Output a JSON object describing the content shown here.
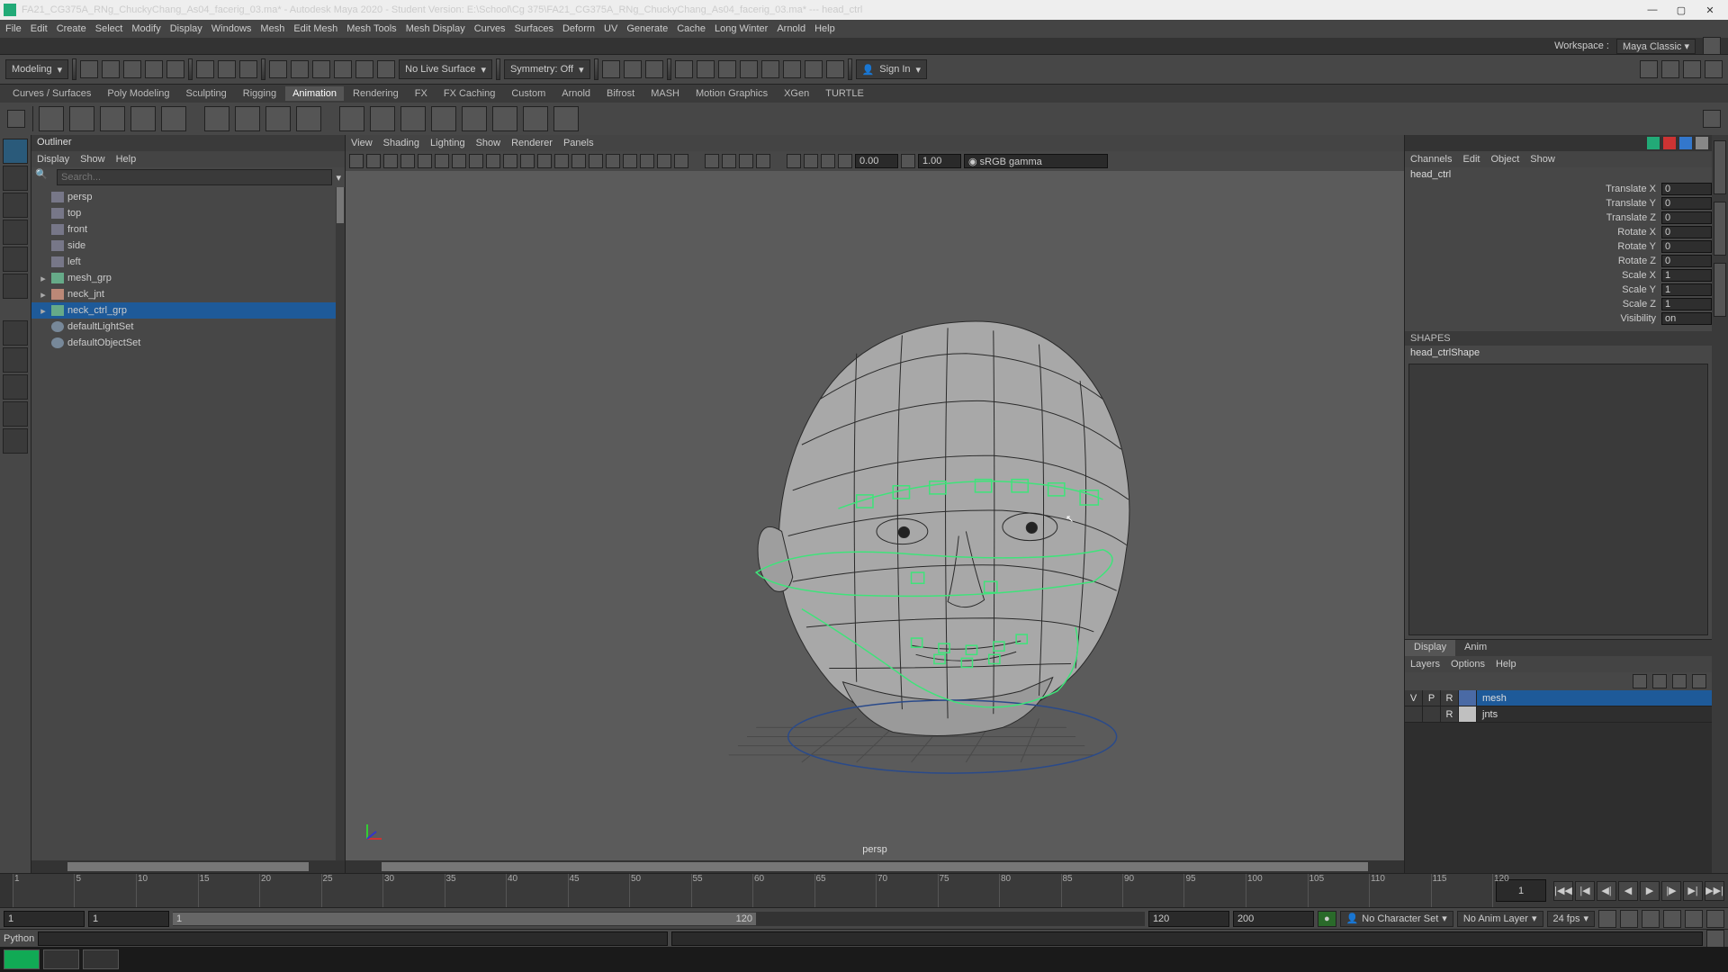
{
  "title": "FA21_CG375A_RNg_ChuckyChang_As04_facerig_03.ma* - Autodesk Maya 2020 - Student Version: E:\\School\\Cg 375\\FA21_CG375A_RNg_ChuckyChang_As04_facerig_03.ma*  ---  head_ctrl",
  "menus": [
    "File",
    "Edit",
    "Create",
    "Select",
    "Modify",
    "Display",
    "Windows",
    "Mesh",
    "Edit Mesh",
    "Mesh Tools",
    "Mesh Display",
    "Curves",
    "Surfaces",
    "Deform",
    "UV",
    "Generate",
    "Cache",
    "Long Winter",
    "Arnold",
    "Help"
  ],
  "workspace": {
    "label": "Workspace :",
    "value": "Maya Classic"
  },
  "menuSet": "Modeling",
  "statusCombos": {
    "liveSurface": "No Live Surface",
    "symmetry": "Symmetry: Off",
    "signIn": "Sign In"
  },
  "shelfTabs": [
    "Curves / Surfaces",
    "Poly Modeling",
    "Sculpting",
    "Rigging",
    "Animation",
    "Rendering",
    "FX",
    "FX Caching",
    "Custom",
    "Arnold",
    "Bifrost",
    "MASH",
    "Motion Graphics",
    "XGen",
    "TURTLE"
  ],
  "shelfActive": "Animation",
  "outliner": {
    "title": "Outliner",
    "menus": [
      "Display",
      "Show",
      "Help"
    ],
    "searchPlaceholder": "Search...",
    "items": [
      {
        "label": "persp",
        "type": "cam",
        "dim": true
      },
      {
        "label": "top",
        "type": "cam",
        "dim": true
      },
      {
        "label": "front",
        "type": "cam",
        "dim": true
      },
      {
        "label": "side",
        "type": "cam",
        "dim": true
      },
      {
        "label": "left",
        "type": "cam",
        "dim": true
      },
      {
        "label": "mesh_grp",
        "type": "grp",
        "expandable": true
      },
      {
        "label": "neck_jnt",
        "type": "jnt",
        "expandable": true
      },
      {
        "label": "neck_ctrl_grp",
        "type": "grp",
        "expandable": true,
        "selected": true
      },
      {
        "label": "defaultLightSet",
        "type": "set"
      },
      {
        "label": "defaultObjectSet",
        "type": "set"
      }
    ]
  },
  "viewpanel": {
    "menus": [
      "View",
      "Shading",
      "Lighting",
      "Show",
      "Renderer",
      "Panels"
    ],
    "gammaField": "sRGB gamma",
    "exposure": "0.00",
    "gamma": "1.00",
    "camera": "persp"
  },
  "channelBox": {
    "menus": [
      "Channels",
      "Edit",
      "Object",
      "Show"
    ],
    "node": "head_ctrl",
    "attrs": [
      {
        "label": "Translate X",
        "value": "0"
      },
      {
        "label": "Translate Y",
        "value": "0"
      },
      {
        "label": "Translate Z",
        "value": "0"
      },
      {
        "label": "Rotate X",
        "value": "0"
      },
      {
        "label": "Rotate Y",
        "value": "0"
      },
      {
        "label": "Rotate Z",
        "value": "0"
      },
      {
        "label": "Scale X",
        "value": "1"
      },
      {
        "label": "Scale Y",
        "value": "1"
      },
      {
        "label": "Scale Z",
        "value": "1"
      },
      {
        "label": "Visibility",
        "value": "on"
      }
    ],
    "shapesHeader": "SHAPES",
    "shape": "head_ctrlShape"
  },
  "layers": {
    "tabs": [
      "Display",
      "Anim"
    ],
    "active": "Display",
    "menus": [
      "Layers",
      "Options",
      "Help"
    ],
    "rows": [
      {
        "v": "V",
        "p": "P",
        "r": "R",
        "color": "#4a6aa5",
        "name": "mesh",
        "selected": true
      },
      {
        "v": "",
        "p": "",
        "r": "R",
        "color": "#c0c0c0",
        "name": "jnts",
        "selected": false
      }
    ]
  },
  "time": {
    "ticks": [
      1,
      5,
      10,
      15,
      20,
      25,
      30,
      35,
      40,
      45,
      50,
      55,
      60,
      65,
      70,
      75,
      80,
      85,
      90,
      95,
      100,
      105,
      110,
      115,
      120
    ],
    "current": "1",
    "rangeStart": "1",
    "rangeInnerStart": "1",
    "rangeInnerEnd": "120",
    "rangeEnd": "200",
    "charSet": "No Character Set",
    "animLayer": "No Anim Layer",
    "fps": "24 fps"
  },
  "cmd": {
    "lang": "Python"
  }
}
